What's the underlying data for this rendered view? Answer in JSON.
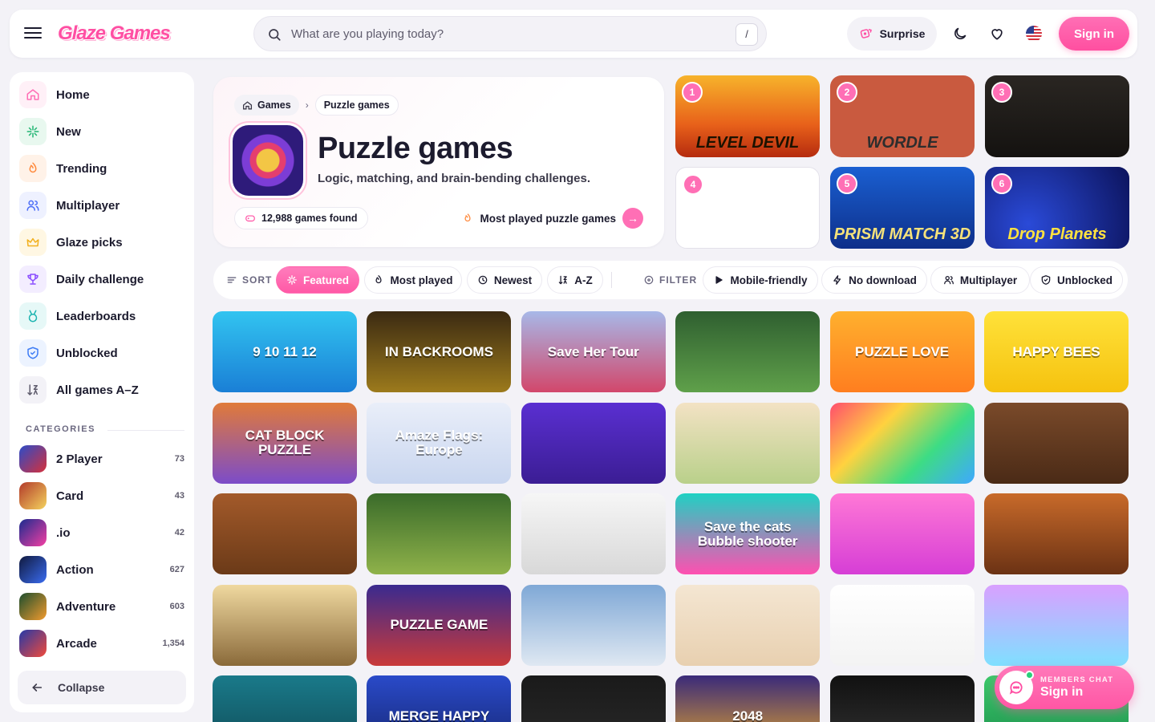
{
  "header": {
    "logo": "Glaze Games",
    "search_placeholder": "What are you playing today?",
    "search_shortcut": "/",
    "surprise_label": "Surprise",
    "signin_label": "Sign in"
  },
  "sidebar": {
    "nav": [
      {
        "label": "Home",
        "icon": "home-icon",
        "color": "#ff6fb5",
        "bg": "#fff0f7"
      },
      {
        "label": "New",
        "icon": "sparkle-icon",
        "color": "#22b573",
        "bg": "#e8f8ef"
      },
      {
        "label": "Trending",
        "icon": "flame-icon",
        "color": "#ff8a3d",
        "bg": "#fff2e8"
      },
      {
        "label": "Multiplayer",
        "icon": "users-icon",
        "color": "#4a6cf7",
        "bg": "#eef1ff"
      },
      {
        "label": "Glaze picks",
        "icon": "crown-icon",
        "color": "#f2b01e",
        "bg": "#fff7e3"
      },
      {
        "label": "Daily challenge",
        "icon": "trophy-icon",
        "color": "#8a4dff",
        "bg": "#f3edff"
      },
      {
        "label": "Leaderboards",
        "icon": "medal-icon",
        "color": "#1db4b0",
        "bg": "#e6f8f7"
      },
      {
        "label": "Unblocked",
        "icon": "shield-icon",
        "color": "#3f7df5",
        "bg": "#ecf3ff"
      },
      {
        "label": "All games A–Z",
        "icon": "sort-az-icon",
        "color": "#5f5c6d",
        "bg": "#f3f2f7"
      }
    ],
    "categories_heading": "CATEGORIES",
    "categories": [
      {
        "label": "2 Player",
        "count": "73",
        "c1": "#2b4cc9",
        "c2": "#d6303b"
      },
      {
        "label": "Card",
        "count": "43",
        "c1": "#b23a2a",
        "c2": "#f4d35e"
      },
      {
        "label": ".io",
        "count": "42",
        "c1": "#1a2b8f",
        "c2": "#f53fa3"
      },
      {
        "label": "Action",
        "count": "627",
        "c1": "#10193d",
        "c2": "#3a6cf0"
      },
      {
        "label": "Adventure",
        "count": "603",
        "c1": "#1b4d2e",
        "c2": "#f29b2e"
      },
      {
        "label": "Arcade",
        "count": "1,354",
        "c1": "#2338a8",
        "c2": "#f24a3a"
      }
    ],
    "collapse_label": "Collapse"
  },
  "hero": {
    "breadcrumb_root": "Games",
    "breadcrumb_current": "Puzzle games",
    "title": "Puzzle games",
    "subtitle": "Logic, matching, and brain-bending challenges.",
    "count_text": "12,988 games found",
    "most_played_link": "Most played puzzle games"
  },
  "featured": [
    {
      "rank": "1",
      "title": "LEVEL DEVIL",
      "bg": "linear-gradient(180deg,#f7b32b 0%,#e8611a 60%,#b52b0f 100%)",
      "fg": "#1c1200"
    },
    {
      "rank": "2",
      "title": "WORDLE",
      "bg": "#c95a3f",
      "fg": "#2d2d2d"
    },
    {
      "rank": "3",
      "title": "",
      "bg": "linear-gradient(180deg,#2a2622,#141210)",
      "fg": "#fff"
    },
    {
      "rank": "4",
      "title": "",
      "bg": "#ffffff",
      "fg": "#333"
    },
    {
      "rank": "5",
      "title": "PRISM MATCH 3D",
      "bg": "linear-gradient(180deg,#1a5fd1,#0e2f8a)",
      "fg": "#f6e27a"
    },
    {
      "rank": "6",
      "title": "Drop Planets",
      "bg": "radial-gradient(circle at 30% 70%,#2a4ad8,#0c135c)",
      "fg": "#ffe23f"
    }
  ],
  "filters": {
    "sort_label": "SORT",
    "sort_options": [
      "Featured",
      "Most played",
      "Newest",
      "A-Z"
    ],
    "active_sort": "Featured",
    "filter_label": "FILTER",
    "filter_options": [
      "Mobile-friendly",
      "No download",
      "Multiplayer",
      "Unblocked"
    ]
  },
  "games": [
    {
      "cap": "9 10 11 12",
      "bg": "linear-gradient(180deg,#32c4f0,#1a7fd6)"
    },
    {
      "cap": "IN BACKROOMS",
      "bg": "linear-gradient(180deg,#3b2a12,#9c7a1c)"
    },
    {
      "cap": "Save Her Tour",
      "bg": "linear-gradient(180deg,#a7b8e8,#d2476b)"
    },
    {
      "cap": "",
      "bg": "linear-gradient(180deg,#2f5f30,#5fa04a)"
    },
    {
      "cap": "PUZZLE LOVE",
      "bg": "linear-gradient(180deg,#ffb02e,#ff7e1f)"
    },
    {
      "cap": "HAPPY BEES",
      "bg": "linear-gradient(180deg,#ffe23a,#f5c20f)"
    },
    {
      "cap": "CAT BLOCK PUZZLE",
      "bg": "linear-gradient(180deg,#e07a3a,#7c4cc9)"
    },
    {
      "cap": "Amaze Flags: Europe",
      "bg": "linear-gradient(180deg,#e9eef9,#c9d6ef)"
    },
    {
      "cap": "",
      "bg": "linear-gradient(180deg,#5a2fd1,#3b1d94)"
    },
    {
      "cap": "",
      "bg": "linear-gradient(180deg,#f3e2c4,#b9d08a)"
    },
    {
      "cap": "",
      "bg": "linear-gradient(135deg,#ff4d6d,#ffd23f,#3ddc84,#3fa8ff)"
    },
    {
      "cap": "",
      "bg": "linear-gradient(180deg,#7a4a2a,#4a2a16)"
    },
    {
      "cap": "",
      "bg": "linear-gradient(180deg,#a35a2a,#6b3a18)"
    },
    {
      "cap": "",
      "bg": "linear-gradient(180deg,#3a6b2a,#8fb24a)"
    },
    {
      "cap": "",
      "bg": "linear-gradient(180deg,#f6f6f6,#d8d8d8)"
    },
    {
      "cap": "Save the cats Bubble shooter",
      "bg": "linear-gradient(180deg,#1fd1c3,#ff4fb0)"
    },
    {
      "cap": "",
      "bg": "linear-gradient(180deg,#ff78d6,#d63ed6)"
    },
    {
      "cap": "",
      "bg": "linear-gradient(180deg,#c86a2a,#6b3214)"
    },
    {
      "cap": "",
      "bg": "linear-gradient(180deg,#f0d9a0,#8a6a3a)"
    },
    {
      "cap": "PUZZLE GAME",
      "bg": "linear-gradient(180deg,#3a2a8f,#c93a3a)"
    },
    {
      "cap": "",
      "bg": "linear-gradient(180deg,#7fa8d6,#dfe8f2)"
    },
    {
      "cap": "",
      "bg": "linear-gradient(180deg,#f4e6d2,#e8d0b0)"
    },
    {
      "cap": "",
      "bg": "linear-gradient(180deg,#ffffff,#f3f3f3)"
    },
    {
      "cap": "",
      "bg": "linear-gradient(180deg,#d9a0ff,#7fe0ff)"
    },
    {
      "cap": "",
      "bg": "linear-gradient(180deg,#1a7a8a,#0f4a55)"
    },
    {
      "cap": "MERGE HAPPY",
      "bg": "linear-gradient(180deg,#2a4ac9,#15256e)"
    },
    {
      "cap": "",
      "bg": "linear-gradient(180deg,#1a1a1a,#2a2a2a)"
    },
    {
      "cap": "2048",
      "bg": "linear-gradient(180deg,#3a2a7a,#e9a92a)"
    },
    {
      "cap": "",
      "bg": "linear-gradient(180deg,#111,#333)"
    },
    {
      "cap": "",
      "bg": "linear-gradient(180deg,#3ac96a,#1a8a4a)"
    }
  ],
  "chat": {
    "small": "MEMBERS CHAT",
    "big": "Sign in"
  }
}
